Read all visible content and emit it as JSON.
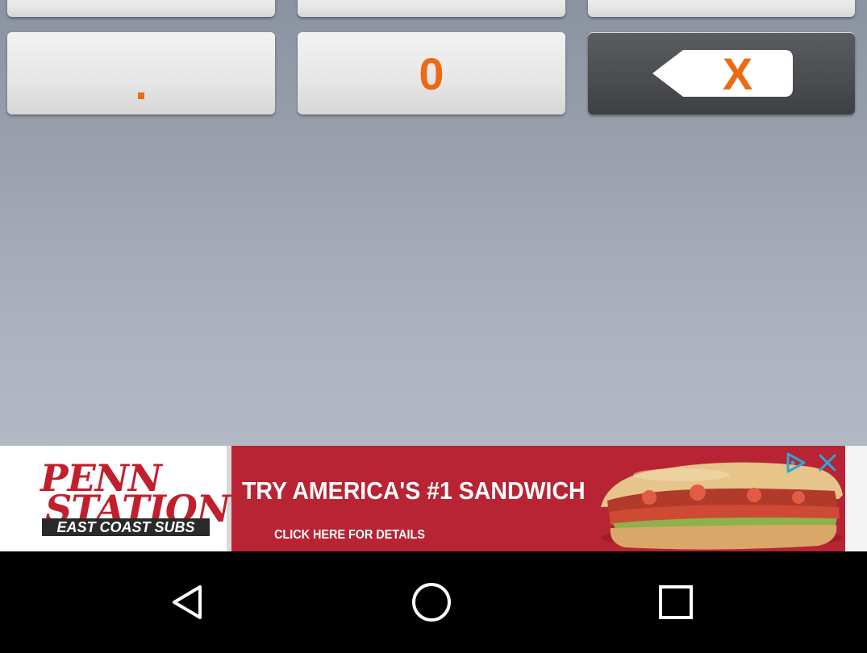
{
  "keypad": {
    "top_row": [
      "",
      "",
      ""
    ],
    "dot_label": ".",
    "zero_label": "0",
    "backspace_label": "X"
  },
  "ad": {
    "logo_line1": "PENN",
    "logo_line2": "STATION",
    "logo_tagline": "EAST COAST SUBS",
    "headline": "TRY AMERICA'S #1 SANDWICH",
    "subline": "CLICK HERE FOR DETAILS",
    "choices_icon": "ad-choices-icon",
    "close_icon": "close-icon"
  },
  "navbar": {
    "back_icon": "back-triangle-icon",
    "home_icon": "home-circle-icon",
    "recent_icon": "recent-apps-square-icon"
  },
  "colors": {
    "accent_orange": "#ec6a14",
    "ad_red": "#b82433",
    "key_dark": "#4a4c50"
  }
}
